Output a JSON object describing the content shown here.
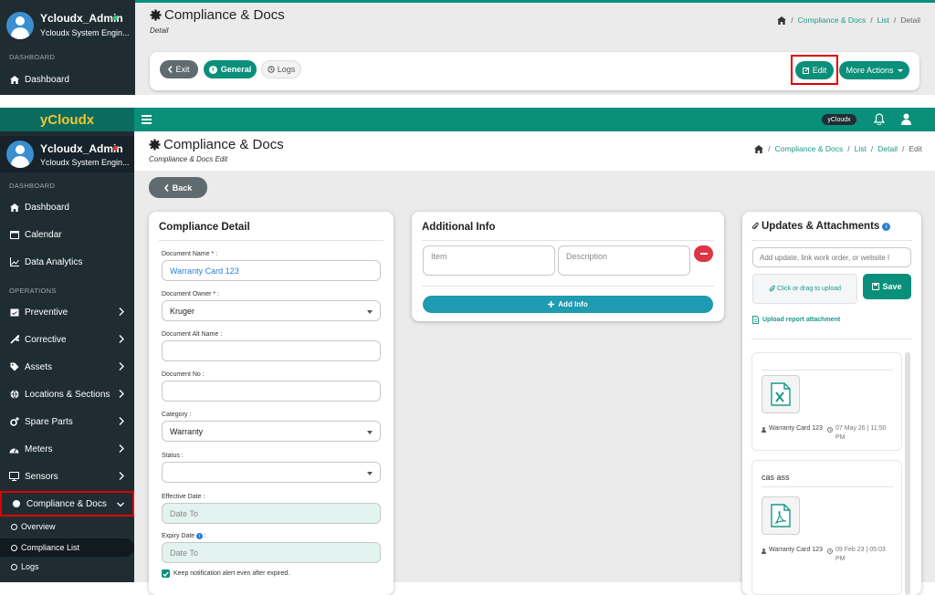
{
  "top_panel": {
    "user": {
      "name": "Ycloudx_Admin",
      "role": "Ycloudx System Engin..."
    },
    "nav_section": "DASHBOARD",
    "nav_dashboard": "Dashboard",
    "page_title": "Compliance & Docs",
    "page_subtitle": "Detail",
    "breadcrumb": {
      "item1": "Compliance & Docs",
      "item2": "List",
      "item3": "Detail"
    },
    "toolbar": {
      "exit": "Exit",
      "general": "General",
      "logs": "Logs",
      "edit": "Edit",
      "more_actions": "More Actions"
    }
  },
  "topbar": {
    "brand": "yCloudx",
    "badge": "yCloudx"
  },
  "sidebar": {
    "user": {
      "name": "Ycloudx_Admin",
      "role": "Ycloudx System Engin..."
    },
    "section_dashboard": "DASHBOARD",
    "section_operations": "OPERATIONS",
    "items": {
      "dashboard": "Dashboard",
      "calendar": "Calendar",
      "data_analytics": "Data Analytics",
      "preventive": "Preventive",
      "corrective": "Corrective",
      "assets": "Assets",
      "locations": "Locations & Sections",
      "spare_parts": "Spare Parts",
      "meters": "Meters",
      "sensors": "Sensors",
      "compliance": "Compliance & Docs"
    },
    "subitems": {
      "overview": "Overview",
      "compliance_list": "Compliance List",
      "logs": "Logs"
    }
  },
  "header": {
    "title": "Compliance & Docs",
    "subtitle": "Compliance & Docs Edit",
    "breadcrumb": {
      "item1": "Compliance & Docs",
      "item2": "List",
      "item3": "Detail",
      "item4": "Edit"
    },
    "back_label": "Back"
  },
  "compliance_detail": {
    "title": "Compliance Detail",
    "fields": {
      "document_name": {
        "label": "Document Name * :",
        "value": "Warranty Card 123"
      },
      "document_owner": {
        "label": "Document Owner * :",
        "value": "Kruger"
      },
      "document_alt_name": {
        "label": "Document Alt Name :",
        "value": ""
      },
      "document_no": {
        "label": "Document No :",
        "value": ""
      },
      "category": {
        "label": "Category :",
        "value": "Warranty"
      },
      "status": {
        "label": "Status :",
        "value": ""
      },
      "effective_date": {
        "label": "Effective Date :",
        "placeholder": "Date To"
      },
      "expiry_date": {
        "label": "Expiry Date",
        "placeholder": "Date To"
      }
    },
    "keep_notification_label": "Keep notification alert even after expired.",
    "keep_notification_checked": true
  },
  "additional_info": {
    "title": "Additional Info",
    "item_placeholder": "Item",
    "description_placeholder": "Description",
    "add_label": "Add Info"
  },
  "updates": {
    "title": "Updates & Attachments",
    "input_placeholder": "Add update, link work order, or website l",
    "upload_label": "Click or drag to upload",
    "save_label": "Save",
    "report_label": "Upload report attachment",
    "entries": [
      {
        "text": "",
        "file_type": "excel-file-icon",
        "author": "Warranty Card 123",
        "timestamp": "07 May 26 | 11:50 PM"
      },
      {
        "text": "cas ass",
        "file_type": "pdf-file-icon",
        "author": "Warranty Card 123",
        "timestamp": "09 Feb 23 | 05:03 PM"
      }
    ]
  },
  "colors": {
    "teal": "#0a8f7a",
    "sidebar": "#1f2d33",
    "brand_yellow": "#f2c52d",
    "highlight_red": "#e00000",
    "danger": "#dc3545"
  }
}
